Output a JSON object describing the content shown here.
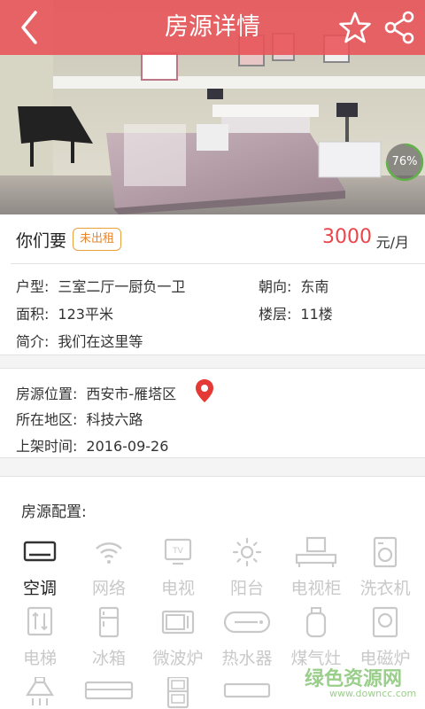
{
  "header": {
    "title": "房源详情",
    "back_icon": "chevron-left-icon",
    "favorite_icon": "star-icon",
    "share_icon": "share-icon",
    "bar_color": "#e85256"
  },
  "photo": {
    "progress": "76%",
    "progress_value": 0.76
  },
  "summary": {
    "name": "你们要",
    "status_badge": "未出租",
    "price": "3000",
    "price_unit": "元/月",
    "price_color": "#e8464a"
  },
  "details": {
    "layout_label": "户型:",
    "layout_value": "三室二厅一厨负一卫",
    "facing_label": "朝向:",
    "facing_value": "东南",
    "area_label": "面积:",
    "area_value": "123平米",
    "floor_label": "楼层:",
    "floor_value": "11楼",
    "intro_label": "简介:",
    "intro_value": "我们在这里等"
  },
  "location": {
    "position_label": "房源位置:",
    "position_value": "西安市-雁塔区",
    "region_label": "所在地区:",
    "region_value": "科技六路",
    "listed_label": "上架时间:",
    "listed_value": "2016-09-26",
    "pin_icon": "map-pin-icon",
    "pin_color": "#e53935"
  },
  "config": {
    "title": "房源配置:",
    "items": [
      {
        "label": "空调",
        "icon": "air-conditioner-icon",
        "available": true
      },
      {
        "label": "网络",
        "icon": "wifi-icon",
        "available": false
      },
      {
        "label": "电视",
        "icon": "tv-icon",
        "available": false
      },
      {
        "label": "阳台",
        "icon": "sun-icon",
        "available": false
      },
      {
        "label": "电视柜",
        "icon": "tv-cabinet-icon",
        "available": false
      },
      {
        "label": "洗衣机",
        "icon": "washing-machine-icon",
        "available": false
      },
      {
        "label": "电梯",
        "icon": "elevator-icon",
        "available": false
      },
      {
        "label": "冰箱",
        "icon": "fridge-icon",
        "available": false
      },
      {
        "label": "微波炉",
        "icon": "microwave-icon",
        "available": false
      },
      {
        "label": "热水器",
        "icon": "water-heater-icon",
        "available": false
      },
      {
        "label": "煤气灶",
        "icon": "gas-stove-icon",
        "available": false
      },
      {
        "label": "电磁炉",
        "icon": "induction-cooker-icon",
        "available": false
      }
    ]
  },
  "watermark": {
    "brand": "绿色资源网",
    "url": "www.downcc.com"
  }
}
